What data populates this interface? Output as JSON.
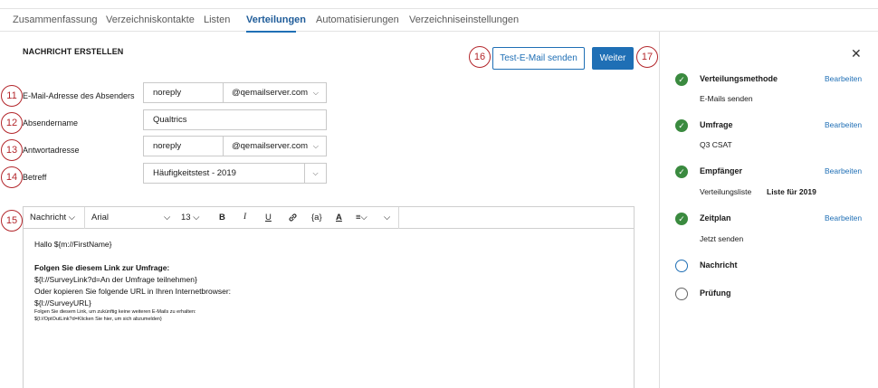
{
  "nav": {
    "tabs": [
      {
        "label": "Zusammenfassung"
      },
      {
        "label": "Verzeichniskontakte"
      },
      {
        "label": "Listen"
      },
      {
        "label": "Verteilungen",
        "active": true
      },
      {
        "label": "Automatisierungen"
      },
      {
        "label": "Verzeichniseinstellungen"
      }
    ]
  },
  "compose": {
    "title": "NACHRICHT ERSTELLEN",
    "test_button": "Test-E-Mail senden",
    "next_button": "Weiter",
    "callouts": [
      "11",
      "12",
      "13",
      "14",
      "15",
      "16",
      "17"
    ],
    "from_label": "E-Mail-Adresse des Absenders",
    "from_value": "noreply",
    "from_domain": "@qemailserver.com",
    "sender_label": "Absendername",
    "sender_value": "Qualtrics",
    "reply_label": "Antwortadresse",
    "reply_value": "noreply",
    "reply_domain": "@qemailserver.com",
    "subject_label": "Betreff",
    "subject_value": "Häufigkeitstest - 2019"
  },
  "editor": {
    "toolbar": {
      "format": "Nachricht",
      "font": "Arial",
      "size": "13",
      "bold": "B",
      "italic": "I",
      "underline": "U",
      "piped": "{a}",
      "textcolor": "A"
    },
    "lines": [
      "Hallo ${m://FirstName}",
      "Folgen Sie diesem Link zur Umfrage:",
      "${l://SurveyLink?d=An der Umfrage teilnehmen}",
      "Oder kopieren Sie folgende URL in Ihren Internetbrowser:",
      "${l://SurveyURL}",
      "Folgen Sie diesem Link, um zukünftig keine weiteren E-Mails zu erhalten:",
      "${l://OptOutLink?d=Klicken Sie hier, um sich abzumelden}"
    ]
  },
  "sidebar": {
    "edit_label": "Bearbeiten",
    "steps": [
      {
        "title": "Verteilungsmethode",
        "sub": "E-Mails senden",
        "status": "done"
      },
      {
        "title": "Umfrage",
        "sub": "Q3 CSAT",
        "status": "done"
      },
      {
        "title": "Empfänger",
        "sub": "Verteilungsliste",
        "sub2": "Liste für 2019",
        "status": "done"
      },
      {
        "title": "Zeitplan",
        "sub": "Jetzt senden",
        "status": "done"
      },
      {
        "title": "Nachricht",
        "status": "current"
      },
      {
        "title": "Prüfung",
        "status": "pending"
      }
    ],
    "colors": {
      "done": "#3a8a3f",
      "accent": "#1f6fb5",
      "callout": "#b3262b"
    }
  }
}
